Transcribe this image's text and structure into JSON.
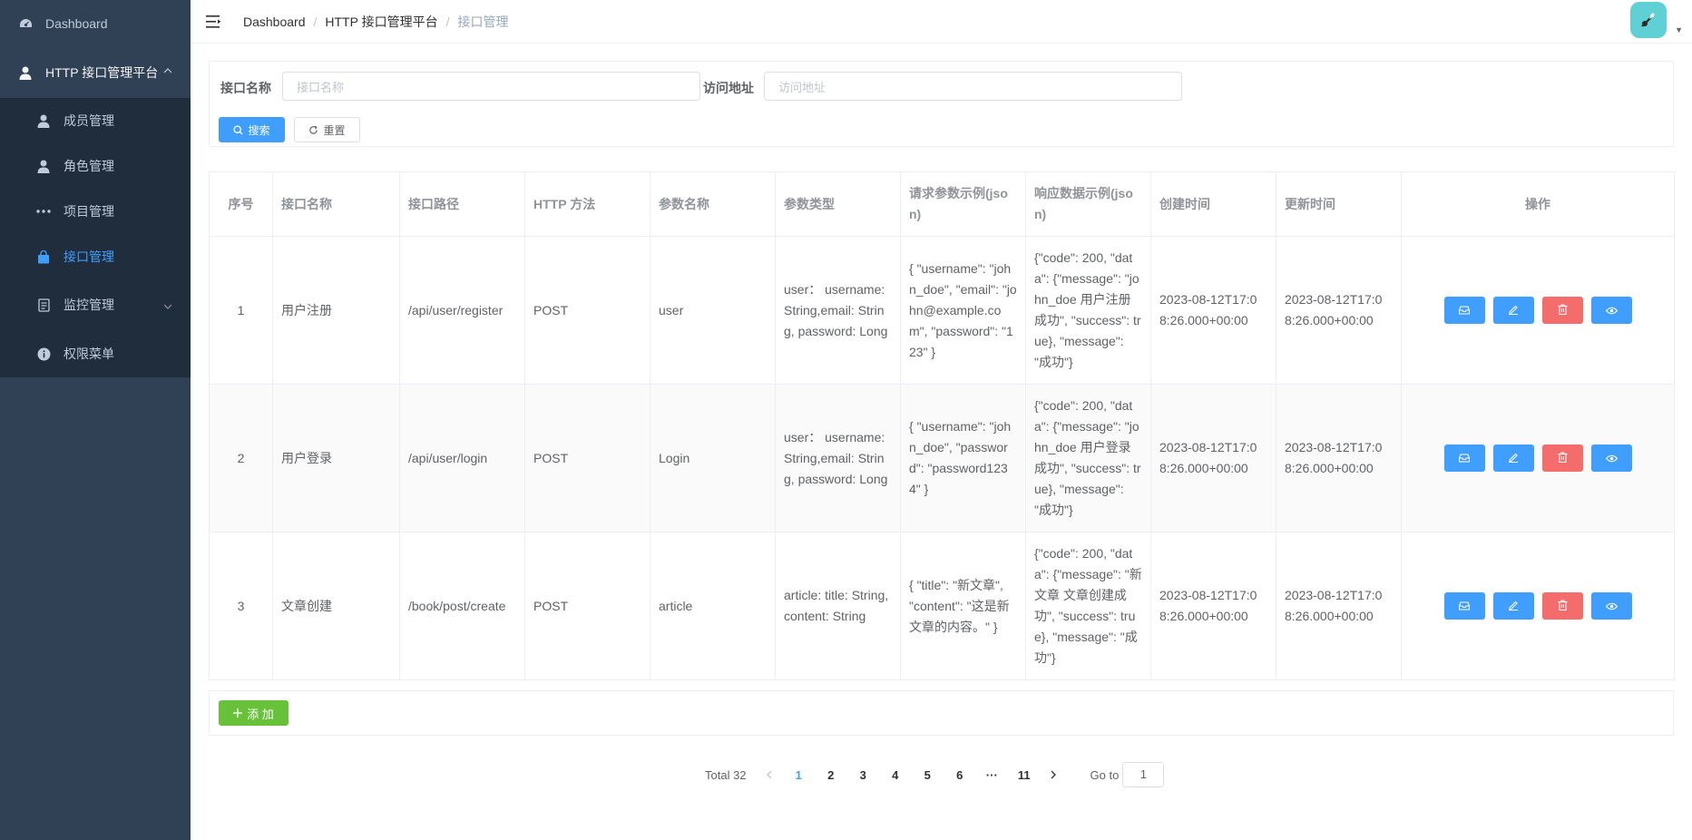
{
  "sidebar": {
    "dashboard": "Dashboard",
    "platform": "HTTP 接口管理平台",
    "items": [
      {
        "label": "成员管理"
      },
      {
        "label": "角色管理"
      },
      {
        "label": "项目管理"
      },
      {
        "label": "接口管理"
      },
      {
        "label": "监控管理"
      },
      {
        "label": "权限菜单"
      }
    ]
  },
  "breadcrumb": [
    "Dashboard",
    "HTTP 接口管理平台",
    "接口管理"
  ],
  "search": {
    "name_label": "接口名称",
    "name_placeholder": "接口名称",
    "url_label": "访问地址",
    "url_placeholder": "访问地址",
    "search_button": "搜索",
    "reset_button": "重置"
  },
  "table": {
    "columns": [
      "序号",
      "接口名称",
      "接口路径",
      "HTTP 方法",
      "参数名称",
      "参数类型",
      "请求参数示例(json)",
      "响应数据示例(json)",
      "创建时间",
      "更新时间",
      "操作"
    ],
    "rows": [
      {
        "index": "1",
        "name": "用户注册",
        "path": "/api/user/register",
        "method": "POST",
        "param_name": "user",
        "param_type": "user： username: String,email: String, password: Long",
        "request_example": "{ \"username\": \"john_doe\", \"email\": \"john@example.com\", \"password\": \"123\" }",
        "response_example": "{\"code\": 200, \"data\": {\"message\": \"john_doe 用户注册成功\", \"success\": true}, \"message\": \"成功\"}",
        "created": "2023-08-12T17:08:26.000+00:00",
        "updated": "2023-08-12T17:08:26.000+00:00"
      },
      {
        "index": "2",
        "name": "用户登录",
        "path": "/api/user/login",
        "method": "POST",
        "param_name": "Login",
        "param_type": "user： username: String,email: String, password: Long",
        "request_example": "{ \"username\": \"john_doe\", \"password\": \"password1234\" }",
        "response_example": "{\"code\": 200, \"data\": {\"message\": \"john_doe 用户登录成功\", \"success\": true}, \"message\": \"成功\"}",
        "created": "2023-08-12T17:08:26.000+00:00",
        "updated": "2023-08-12T17:08:26.000+00:00"
      },
      {
        "index": "3",
        "name": "文章创建",
        "path": "/book/post/create",
        "method": "POST",
        "param_name": "article",
        "param_type": "article: title: String, content: String",
        "request_example": "{ \"title\": \"新文章\", \"content\": \"这是新文章的内容。\" }",
        "response_example": "{\"code\": 200, \"data\": {\"message\": \"新文章 文章创建成功\", \"success\": true}, \"message\": \"成功\"}",
        "created": "2023-08-12T17:08:26.000+00:00",
        "updated": "2023-08-12T17:08:26.000+00:00"
      }
    ]
  },
  "add_button": "添 加",
  "pagination": {
    "total": "Total 32",
    "pages": [
      "1",
      "2",
      "3",
      "4",
      "5",
      "6",
      "···",
      "11"
    ],
    "current": "1",
    "goto_label": "Go to",
    "goto_value": "1"
  },
  "colors": {
    "sidebar_bg": "#304156",
    "submenu_bg": "#1f2d3d",
    "primary": "#409eff",
    "danger": "#f56c6c",
    "success": "#67c23a",
    "avatar_bg": "#5fd0d3"
  },
  "icons": {
    "dashboard": "dashboard-icon",
    "user": "user-icon",
    "more": "more-icon",
    "bag": "bag-icon",
    "document": "document-icon",
    "info": "info-icon",
    "hamburger": "hamburger-icon",
    "search": "search-icon",
    "refresh": "refresh-icon",
    "edit": "edit-icon",
    "delete": "delete-icon",
    "view": "view-icon",
    "box": "box-icon"
  }
}
